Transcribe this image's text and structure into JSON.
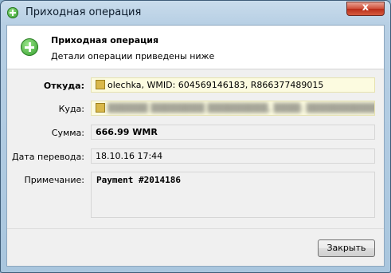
{
  "window": {
    "title": "Приходная операция",
    "close_symbol": "x"
  },
  "header": {
    "icon": "add-circle-icon",
    "title": "Приходная операция",
    "subtitle": "Детали операции приведены ниже"
  },
  "fields": {
    "from": {
      "label": "Откуда:",
      "value": "olechka, WMID: 604569146183, R866377489015"
    },
    "to": {
      "label": "Куда:"
    },
    "amount": {
      "label": "Сумма:",
      "value": "666.99 WMR"
    },
    "date": {
      "label": "Дата перевода:",
      "value": "18.10.16 17:44"
    },
    "note": {
      "label": "Примечание:",
      "value": "Payment  #2014186"
    }
  },
  "buttons": {
    "close": "Закрыть"
  },
  "colors": {
    "title_bar": "#b7cfe4",
    "close_button": "#cf4e38",
    "highlight_field": "#fcfbe0"
  }
}
